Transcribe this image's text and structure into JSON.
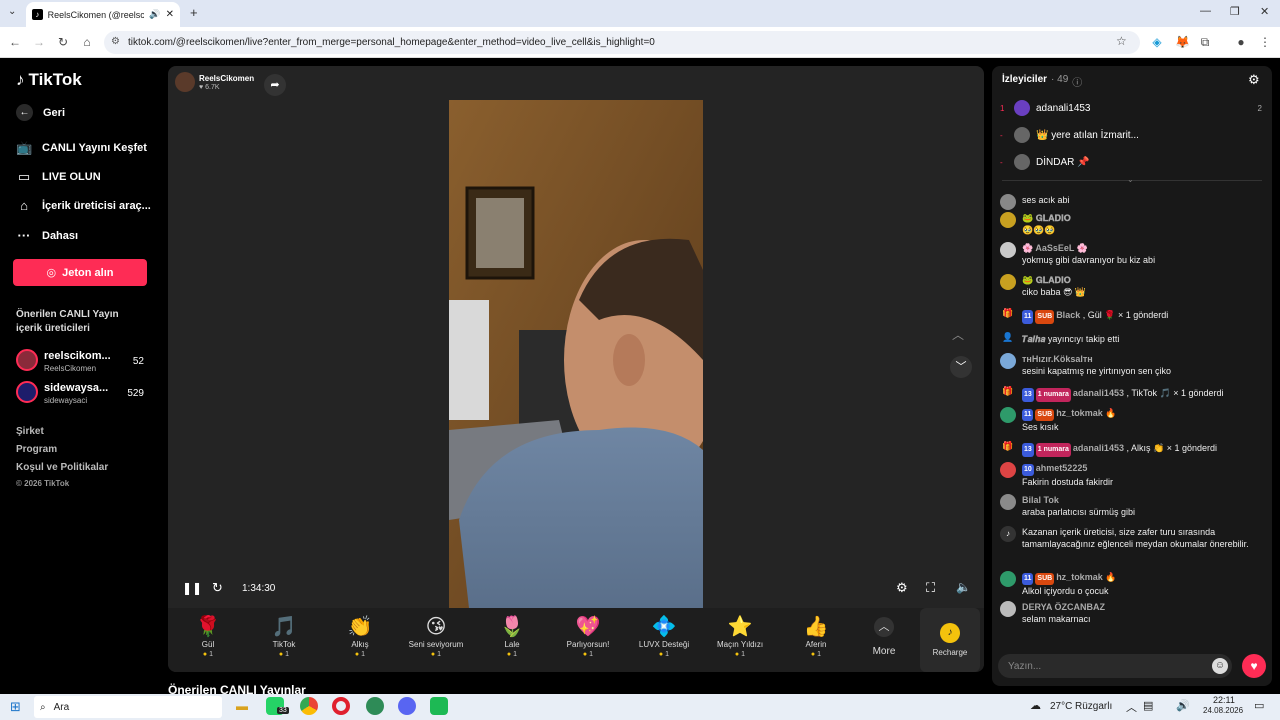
{
  "browser": {
    "tab_title": "ReelsCikomen (@reelscikomen)",
    "url": "tiktok.com/@reelscikomen/live?enter_from_merge=personal_homepage&enter_method=video_live_cell&is_highlight=0"
  },
  "sidebar": {
    "logo": "TikTok",
    "back": "Geri",
    "items": [
      {
        "label": "CANLI Yayını Keşfet",
        "icon": "tv-icon"
      },
      {
        "label": "LIVE OLUN",
        "icon": "camera-icon"
      },
      {
        "label": "İçerik üreticisi araç...",
        "icon": "creator-tools-icon"
      },
      {
        "label": "Dahası",
        "icon": "more-icon"
      }
    ],
    "jeton_button": "Jeton alın",
    "suggested_title": "Önerilen CANLI Yayın içerik üreticileri",
    "creators": [
      {
        "name": "reelscikom...",
        "handle": "ReelsCikomen",
        "count": "52"
      },
      {
        "name": "sidewaysa...",
        "handle": "sidewaysaci",
        "count": "529"
      }
    ],
    "footer": [
      "Şirket",
      "Program",
      "Koşul ve Politikalar"
    ],
    "copyright": "© 2026 TikTok"
  },
  "player": {
    "host_name": "ReelsCikomen",
    "host_likes": "6.7K",
    "time": "1:34:30",
    "more_label": "More",
    "recharge_label": "Recharge",
    "gifts": [
      {
        "name": "Gül",
        "cost": "1",
        "icon": "rose-icon",
        "glyph": "🌹"
      },
      {
        "name": "TikTok",
        "cost": "1",
        "icon": "tiktok-gift-icon",
        "glyph": "🎵"
      },
      {
        "name": "Alkış",
        "cost": "1",
        "icon": "clap-icon",
        "glyph": "👏"
      },
      {
        "name": "Seni seviyorum",
        "cost": "1",
        "icon": "love-icon",
        "glyph": "😘"
      },
      {
        "name": "Lale",
        "cost": "1",
        "icon": "tulip-icon",
        "glyph": "🌷"
      },
      {
        "name": "Parlıyorsun!",
        "cost": "1",
        "icon": "shine-icon",
        "glyph": "💖"
      },
      {
        "name": "LUVX Desteği",
        "cost": "1",
        "icon": "luvx-icon",
        "glyph": "💠"
      },
      {
        "name": "Maçın Yıldızı",
        "cost": "1",
        "icon": "star-icon",
        "glyph": "⭐"
      },
      {
        "name": "Aferin",
        "cost": "1",
        "icon": "thumbs-up-icon",
        "glyph": "👍"
      }
    ],
    "next_section": "Önerilen CANLI Yayınlar"
  },
  "chat": {
    "viewers_label": "İzleyiciler",
    "viewers_count": "· 49",
    "top_viewers": [
      {
        "rank": "1",
        "name": "adanali1453",
        "score": "2"
      },
      {
        "rank": "-",
        "name": "👑 уеrе atılan İzmarit...",
        "score": ""
      },
      {
        "rank": "-",
        "name": "DİNDAR 📌",
        "score": ""
      }
    ],
    "messages": [
      {
        "user": "",
        "text": "ses acık abi",
        "kind": "msg"
      },
      {
        "user": "🐸 𝐆𝐋𝐀𝐃𝐈𝐎",
        "text": "🥹🥹🥹",
        "kind": "msg"
      },
      {
        "user": "🌸 AaSsEeL 🌸",
        "text": "yokmuş gibi davranıyor bu kiz abi",
        "kind": "msg"
      },
      {
        "user": "🐸 𝐆𝐋𝐀𝐃𝐈𝐎",
        "text": "ciko baba 😎 👑",
        "kind": "msg"
      },
      {
        "user": "Black",
        "text": ", Gül 🌹 × 1 gönderdi",
        "kind": "gift",
        "badges": [
          "11",
          "SUB"
        ]
      },
      {
        "user": "𝑻𝒂𝒍𝒉𝒂",
        "text": "yayıncıyı takip etti",
        "kind": "follow"
      },
      {
        "user": "тнHızır.Köksalтн",
        "text": "sesini kapatmış ne yirtınıyon sen çiko",
        "kind": "msg"
      },
      {
        "user": "adanali1453",
        "text": ", TikTok 🎵 × 1 gönderdi",
        "kind": "gift",
        "badges": [
          "13",
          "1 numara"
        ]
      },
      {
        "user": "hz_tokmak 🔥",
        "text": "Ses kısık",
        "kind": "msg",
        "badges": [
          "11",
          "SUB"
        ]
      },
      {
        "user": "adanali1453",
        "text": ", Alkış 👏 × 1 gönderdi",
        "kind": "gift",
        "badges": [
          "13",
          "1 numara"
        ]
      },
      {
        "user": "ahmet52225",
        "text": "Fakirin dostuda fakirdir",
        "kind": "msg",
        "badges": [
          "10"
        ]
      },
      {
        "user": "Bilal Tok",
        "text": "araba parlatıcısı sürmüş gibi",
        "kind": "msg"
      },
      {
        "user": "",
        "text": "Kazanan içerik üreticisi, size zafer turu sırasında tamamlayacağınız eğlenceli meydan okumalar önerebilir.",
        "kind": "system"
      },
      {
        "user": "hz_tokmak 🔥",
        "text": "Alkol içiyordu o çocuk",
        "kind": "msg",
        "badges": [
          "11",
          "SUB"
        ]
      },
      {
        "user": "DERYA ÖZCANBAZ",
        "text": "selam makarnacı",
        "kind": "msg"
      }
    ],
    "input_placeholder": "Yazın..."
  },
  "taskbar": {
    "search": "Ara",
    "weather": "27°C",
    "weather_text": "Rüzgarlı",
    "time": "22:11",
    "date": "24.08.2026",
    "badge": "33"
  }
}
